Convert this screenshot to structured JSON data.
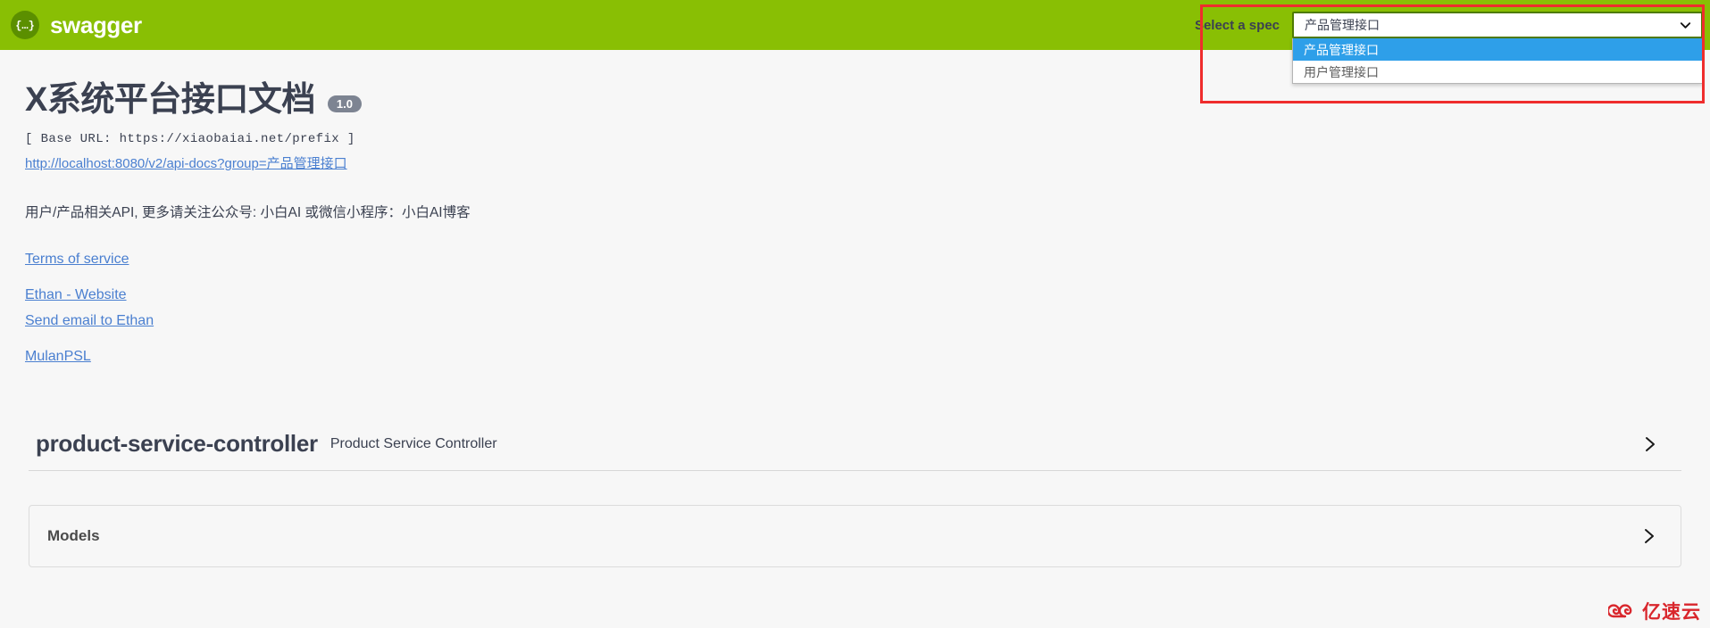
{
  "topbar": {
    "logo_text": "swagger",
    "logo_glyph": "{...}",
    "logo_icon": "swagger-braces-icon",
    "select_spec_label": "Select a spec",
    "green": "#89bf04"
  },
  "spec_select": {
    "selected_value": "产品管理接口",
    "arrow_icon": "chevron-down-icon",
    "options": [
      {
        "label": "产品管理接口",
        "selected": true
      },
      {
        "label": "用户管理接口",
        "selected": false
      }
    ]
  },
  "annotation": {
    "color": "#ef2d2d",
    "name": "red-highlight-rectangle"
  },
  "info": {
    "title": "X系统平台接口文档",
    "version": "1.0",
    "base_url": "[ Base URL: https://xiaobaiai.net/prefix ]",
    "docs_link": "http://localhost:8080/v2/api-docs?group=产品管理接口",
    "description": "用户/产品相关API, 更多请关注公众号: 小白AI 或微信小程序：小白AI博客",
    "links": [
      {
        "label": "Terms of service",
        "spaced": false
      },
      {
        "label": "Ethan - Website",
        "spaced": true
      },
      {
        "label": "Send email to Ethan",
        "spaced": false
      },
      {
        "label": "MulanPSL",
        "spaced": true
      }
    ]
  },
  "tags": [
    {
      "name": "product-service-controller",
      "description": "Product Service Controller",
      "expand_icon": "chevron-right-icon"
    }
  ],
  "models": {
    "title": "Models",
    "expand_icon": "chevron-right-icon"
  },
  "watermark": {
    "text": "亿速云",
    "icon": "cloud-logo-icon",
    "color": "#d9262c"
  }
}
